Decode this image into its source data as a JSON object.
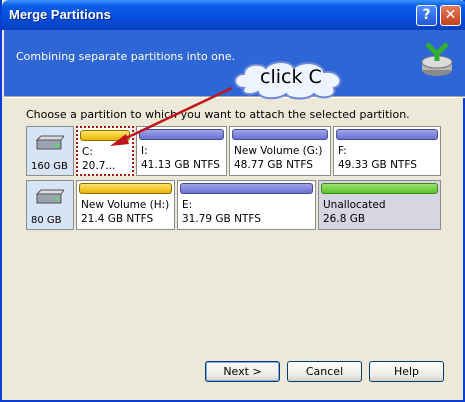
{
  "window": {
    "title": "Merge Partitions"
  },
  "titlebar": {
    "help_label": "?",
    "close_label": "✕"
  },
  "header": {
    "subtitle": "Combining separate partitions into one.",
    "logo_icon": "merge-logo-icon"
  },
  "annotation": {
    "callout_text": "click C"
  },
  "main": {
    "instruction": "Choose a partition to which you want to attach the selected partition.",
    "disks": [
      {
        "size": "160 GB",
        "partitions": [
          {
            "name": "C:",
            "detail": "20.7...",
            "color": "yellow",
            "selected": true
          },
          {
            "name": "I:",
            "detail": "41.13 GB  NTFS",
            "color": "blue"
          },
          {
            "name": "New Volume (G:)",
            "detail": "48.77 GB  NTFS",
            "color": "blue"
          },
          {
            "name": "F:",
            "detail": "49.33 GB  NTFS",
            "color": "blue"
          }
        ]
      },
      {
        "size": "80 GB",
        "partitions": [
          {
            "name": "New Volume (H:)",
            "detail": "21.4 GB  NTFS",
            "color": "yellow"
          },
          {
            "name": "E:",
            "detail": "31.79 GB  NTFS",
            "color": "blue"
          },
          {
            "name": "Unallocated",
            "detail": "26.8 GB",
            "color": "green"
          }
        ]
      }
    ]
  },
  "buttons": {
    "next": "Next >",
    "cancel": "Cancel",
    "help": "Help"
  },
  "colors": {
    "titlebar": "#0550dc",
    "header": "#2f66d6",
    "arrow": "#c0141c",
    "dialog": "#ece9d8"
  }
}
